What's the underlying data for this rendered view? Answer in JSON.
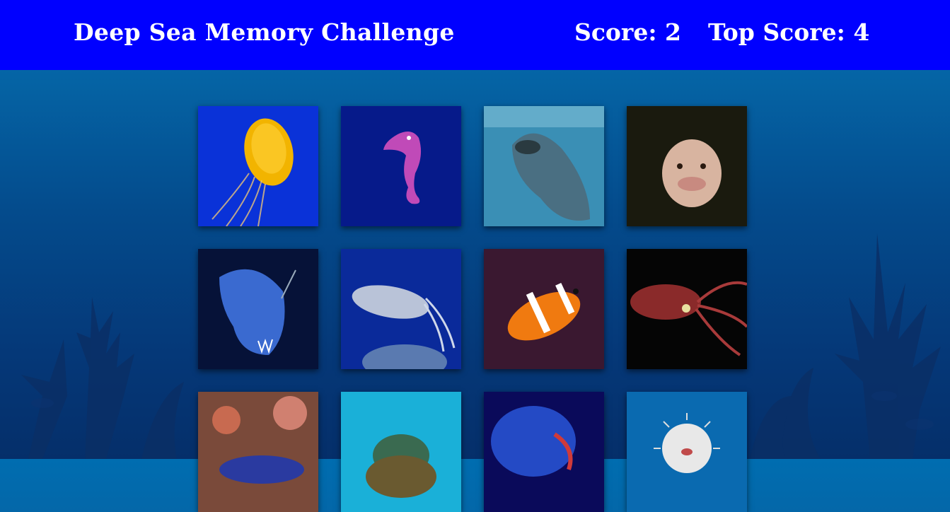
{
  "header": {
    "title": "Deep Sea Memory Challenge",
    "score_text": "Score: 2",
    "top_score_text": "Top Score: 4"
  },
  "game": {
    "score": 2,
    "top_score": 4
  },
  "cards": [
    {
      "creature": "jellyfish",
      "bg": "#0a32d8"
    },
    {
      "creature": "seahorse",
      "bg": "#061a8a"
    },
    {
      "creature": "whale-shark",
      "bg": "#3a8fb5"
    },
    {
      "creature": "blobfish",
      "bg": "#1a1a0e"
    },
    {
      "creature": "anglerfish",
      "bg": "#061238"
    },
    {
      "creature": "cuttlefish",
      "bg": "#0a2a9a"
    },
    {
      "creature": "clownfish",
      "bg": "#3a1830"
    },
    {
      "creature": "squid",
      "bg": "#050505"
    },
    {
      "creature": "nudibranch",
      "bg": "#7a4a3a"
    },
    {
      "creature": "sea-turtle",
      "bg": "#1ab0d8"
    },
    {
      "creature": "glowing-shrimp",
      "bg": "#0a0a5a"
    },
    {
      "creature": "pufferfish",
      "bg": "#0a6ab0"
    }
  ]
}
